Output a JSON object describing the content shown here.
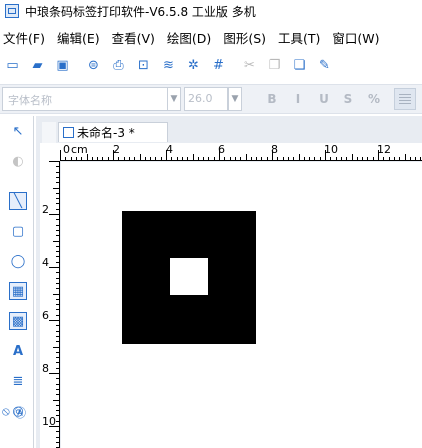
{
  "window": {
    "title": "中琅条码标签打印软件-V6.5.8 工业版 多机"
  },
  "menu": {
    "items": [
      {
        "label": "文件(F)"
      },
      {
        "label": "编辑(E)"
      },
      {
        "label": "查看(V)"
      },
      {
        "label": "绘图(D)"
      },
      {
        "label": "图形(S)"
      },
      {
        "label": "工具(T)"
      },
      {
        "label": "窗口(W)"
      }
    ]
  },
  "toolbar": {
    "icons": [
      "new-file-icon",
      "open-folder-icon",
      "save-icon",
      "database-icon",
      "print-icon",
      "print-preview-icon",
      "layers-icon",
      "settings-icon",
      "grid-icon",
      "cut-icon",
      "copy-icon",
      "paste-icon",
      "pen-icon"
    ]
  },
  "format": {
    "font_placeholder": "字体名称",
    "font_size": "26.0",
    "bold": "B",
    "italic": "I",
    "underline": "U",
    "strike": "S",
    "more": "%"
  },
  "document": {
    "tab_label": "未命名-3 *"
  },
  "ruler": {
    "horizontal_labels": [
      "0",
      "cm",
      "2",
      "4",
      "6",
      "8",
      "10",
      "12"
    ],
    "vertical_labels": [
      "2",
      "4",
      "6",
      "8",
      "10"
    ]
  },
  "colors": {
    "accent": "#2a6fc9",
    "shape_fill": "#000000"
  }
}
